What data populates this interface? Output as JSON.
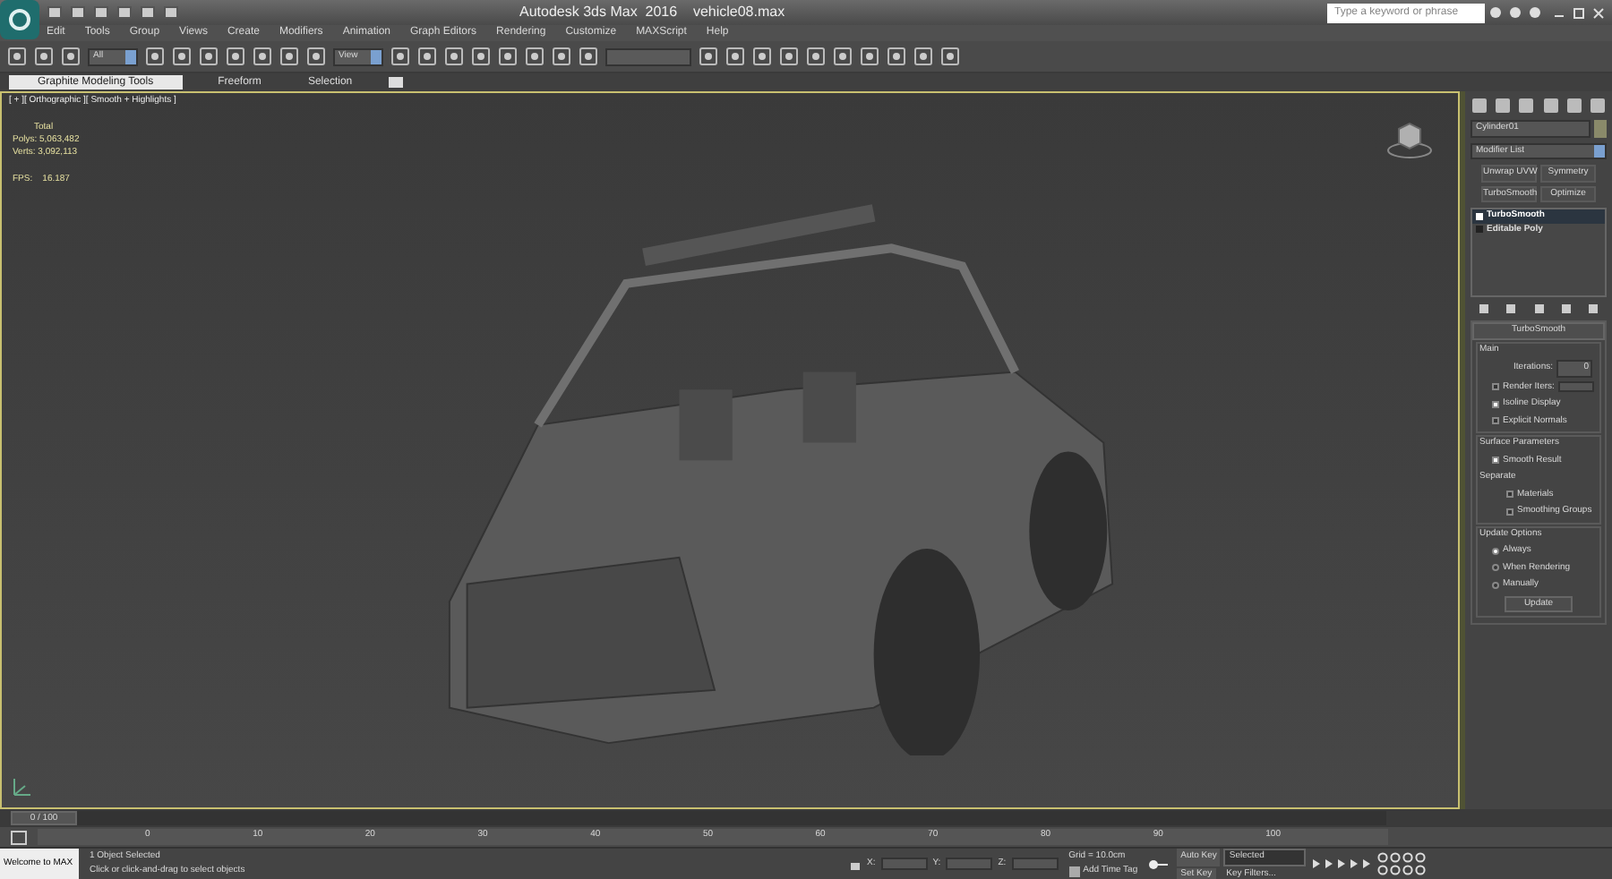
{
  "title_bar": {
    "title": "Autodesk 3ds Max  2016    vehicle08.max",
    "search": {
      "placeholder": "Type a keyword or phrase"
    }
  },
  "menu": [
    "Edit",
    "Tools",
    "Group",
    "Views",
    "Create",
    "Modifiers",
    "Animation",
    "Graph Editors",
    "Rendering",
    "Customize",
    "MAXScript",
    "Help"
  ],
  "toolbar": {
    "selection_filter": "All",
    "reference_coord": "View"
  },
  "ribbon_tabs": [
    {
      "label": "Graphite Modeling Tools",
      "selected": true
    },
    {
      "label": "Freeform",
      "selected": false
    },
    {
      "label": "Selection",
      "selected": false
    }
  ],
  "viewport": {
    "label": "[ + ][ Orthographic ][ Smooth + Highlights ]",
    "stats": [
      "Total",
      "Polys: 5,063,482",
      "Verts: 3,092,113"
    ],
    "fps": "FPS:    16.187"
  },
  "command_panel": {
    "object_name": "Cylinder01",
    "modifier_list": "Modifier List",
    "modifier_buttons": [
      "Unwrap UVW",
      "Symmetry",
      "TurboSmooth",
      "Optimize"
    ],
    "stack": [
      {
        "label": "TurboSmooth",
        "selected": true
      },
      {
        "label": "Editable Poly",
        "selected": false
      }
    ],
    "rollout": {
      "title": "TurboSmooth",
      "main": "Main",
      "iterations_label": "Iterations:",
      "iterations": "0",
      "render_iters": {
        "label": "Render Iters:",
        "checked": false
      },
      "options": [
        {
          "label": "Isoline Display",
          "checked": true
        },
        {
          "label": "Explicit Normals",
          "checked": false
        }
      ],
      "surface": "Surface Parameters",
      "smooth_result": {
        "label": "Smooth Result",
        "checked": true
      },
      "separate": "Separate",
      "separate_options": [
        {
          "label": "Materials",
          "checked": false
        },
        {
          "label": "Smoothing Groups",
          "checked": false
        }
      ],
      "update_options": "Update Options",
      "update_modes": [
        {
          "label": "Always",
          "selected": true
        },
        {
          "label": "When Rendering",
          "selected": false
        },
        {
          "label": "Manually",
          "selected": false
        }
      ],
      "update_button": "Update"
    }
  },
  "timeline": {
    "frame": "0 / 100",
    "level": 0,
    "ticks": [
      "0",
      "10",
      "20",
      "30",
      "40",
      "50",
      "60",
      "70",
      "80",
      "90",
      "100"
    ]
  },
  "status_bar": {
    "maxscript": "Welcome to MAX",
    "selection": "1 Object Selected",
    "prompt": "Click or click-and-drag to select objects",
    "coords": [
      "X:",
      "Y:",
      "Z:"
    ],
    "grid": "Grid = 10.0cm",
    "time_tag": "Add Time Tag",
    "auto_key": "Auto Key",
    "key_mode": "Selected",
    "set_key": "Set Key",
    "key_filters": "Key Filters..."
  }
}
